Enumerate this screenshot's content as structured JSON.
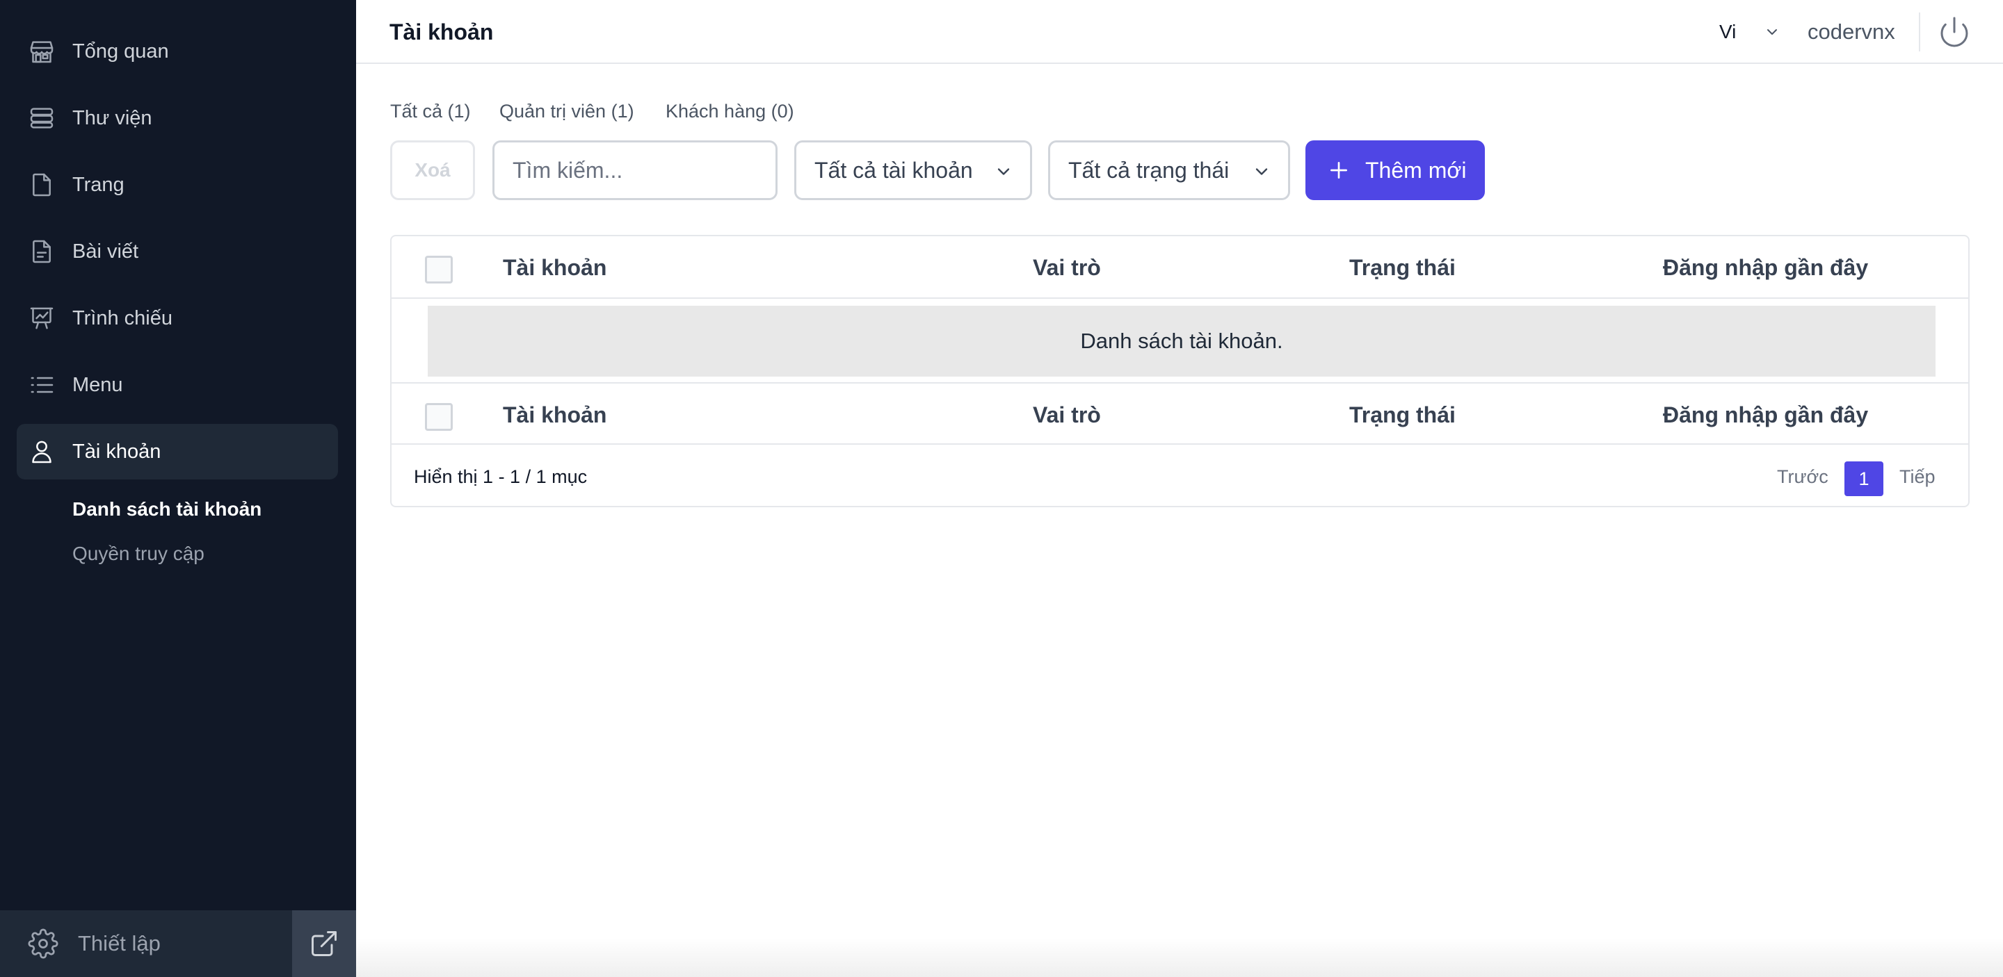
{
  "sidebar": {
    "items": [
      {
        "label": "Tổng quan",
        "icon": "store-icon"
      },
      {
        "label": "Thư viện",
        "icon": "library-icon"
      },
      {
        "label": "Trang",
        "icon": "page-icon"
      },
      {
        "label": "Bài viết",
        "icon": "post-icon"
      },
      {
        "label": "Trình chiếu",
        "icon": "presentation-chart-icon"
      },
      {
        "label": "Menu",
        "icon": "list-icon"
      },
      {
        "label": "Tài khoản",
        "icon": "user-icon",
        "active": true
      }
    ],
    "sub_items": [
      {
        "label": "Danh sách tài khoản",
        "active": true
      },
      {
        "label": "Quyền truy cập"
      }
    ],
    "footer": {
      "settings_label": "Thiết lập",
      "settings_icon": "gear-icon",
      "external_icon": "external-link-icon"
    }
  },
  "header": {
    "title": "Tài khoản",
    "language": "Vi",
    "username": "codervnx",
    "power_icon": "power-icon"
  },
  "filters": {
    "tabs": [
      "Tất cả (1)",
      "Quản trị viên (1)",
      "Khách hàng (0)"
    ]
  },
  "toolbar": {
    "delete_label": "Xoá",
    "search_placeholder": "Tìm kiếm...",
    "account_filter": "Tất cả tài khoản",
    "status_filter": "Tất cả trạng thái",
    "add_label": "Thêm mới"
  },
  "table": {
    "columns": [
      "Tài khoản",
      "Vai trò",
      "Trạng thái",
      "Đăng nhập gần đây"
    ],
    "empty_message": "Danh sách tài khoản.",
    "showing": "Hiển thị 1 - 1 / 1 mục",
    "pagination": {
      "prev": "Trước",
      "current": "1",
      "next": "Tiếp"
    }
  },
  "colors": {
    "sidebar_bg": "#111827",
    "sidebar_active": "#1f2937",
    "accent": "#4f46e5"
  }
}
